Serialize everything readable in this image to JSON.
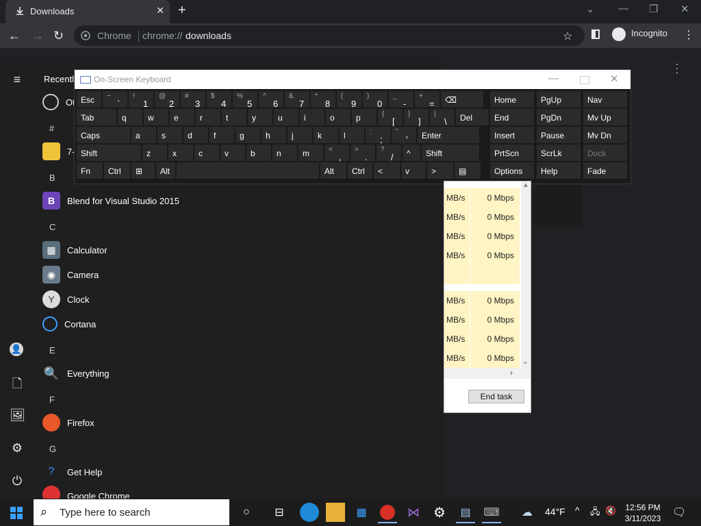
{
  "chrome": {
    "tab_title": "Downloads",
    "omnibox_chip": "Chrome",
    "url_scheme": "chrome://",
    "url_host": "downloads",
    "incognito_label": "Incognito"
  },
  "startmenu": {
    "recently_label": "Recently",
    "letters": [
      "#",
      "B",
      "C",
      "E",
      "F",
      "G"
    ],
    "apps": [
      {
        "label": "Ot"
      },
      {
        "label": "7-"
      },
      {
        "label": "Blend for Visual Studio 2015"
      },
      {
        "label": "Calculator"
      },
      {
        "label": "Camera"
      },
      {
        "label": "Clock"
      },
      {
        "label": "Cortana"
      },
      {
        "label": "Everything"
      },
      {
        "label": "Firefox"
      },
      {
        "label": "Get Help"
      },
      {
        "label": "Google Chrome"
      }
    ]
  },
  "osk": {
    "title": "On-Screen Keyboard",
    "row1": [
      {
        "main": "Esc"
      },
      {
        "sh": "~",
        "base": "`"
      },
      {
        "sh": "!",
        "base": "1"
      },
      {
        "sh": "@",
        "base": "2"
      },
      {
        "sh": "#",
        "base": "3"
      },
      {
        "sh": "$",
        "base": "4"
      },
      {
        "sh": "%",
        "base": "5"
      },
      {
        "sh": "^",
        "base": "6"
      },
      {
        "sh": "&",
        "base": "7"
      },
      {
        "sh": "*",
        "base": "8"
      },
      {
        "sh": "(",
        "base": "9"
      },
      {
        "sh": ")",
        "base": "0"
      },
      {
        "sh": "_",
        "base": "-"
      },
      {
        "sh": "+",
        "base": "="
      },
      {
        "main": "⌫"
      }
    ],
    "row2": [
      {
        "main": "Tab"
      },
      {
        "main": "q"
      },
      {
        "main": "w"
      },
      {
        "main": "e"
      },
      {
        "main": "r"
      },
      {
        "main": "t"
      },
      {
        "main": "y"
      },
      {
        "main": "u"
      },
      {
        "main": "i"
      },
      {
        "main": "o"
      },
      {
        "main": "p"
      },
      {
        "sh": "{",
        "base": "["
      },
      {
        "sh": "}",
        "base": "]"
      },
      {
        "sh": "|",
        "base": "\\"
      },
      {
        "main": "Del"
      }
    ],
    "row3": [
      {
        "main": "Caps"
      },
      {
        "main": "a"
      },
      {
        "main": "s"
      },
      {
        "main": "d"
      },
      {
        "main": "f"
      },
      {
        "main": "g"
      },
      {
        "main": "h"
      },
      {
        "main": "j"
      },
      {
        "main": "k"
      },
      {
        "main": "l"
      },
      {
        "sh": ":",
        "base": ";"
      },
      {
        "sh": "\"",
        "base": "'"
      },
      {
        "main": "Enter"
      }
    ],
    "row4": [
      {
        "main": "Shift"
      },
      {
        "main": "z"
      },
      {
        "main": "x"
      },
      {
        "main": "c"
      },
      {
        "main": "v"
      },
      {
        "main": "b"
      },
      {
        "main": "n"
      },
      {
        "main": "m"
      },
      {
        "sh": "<",
        "base": ","
      },
      {
        "sh": ">",
        "base": "."
      },
      {
        "sh": "?",
        "base": "/"
      },
      {
        "main": "^"
      },
      {
        "main": "Shift"
      }
    ],
    "row5": [
      {
        "main": "Fn"
      },
      {
        "main": "Ctrl"
      },
      {
        "main": "⊞"
      },
      {
        "main": "Alt"
      },
      {
        "main": ""
      },
      {
        "main": "Alt"
      },
      {
        "main": "Ctrl"
      },
      {
        "main": "<"
      },
      {
        "main": "v"
      },
      {
        "main": ">"
      },
      {
        "main": "▤"
      }
    ],
    "nav_keys": [
      [
        "Home",
        "PgUp",
        "Nav"
      ],
      [
        "End",
        "PgDn",
        "Mv Up"
      ],
      [
        "Insert",
        "Pause",
        "Mv Dn"
      ],
      [
        "PrtScn",
        "ScrLk",
        "Dock"
      ],
      [
        "Options",
        "Help",
        "Fade"
      ]
    ]
  },
  "taskmgr": {
    "rows": [
      {
        "c1": "MB/s",
        "c2": "0 Mbps"
      },
      {
        "c1": "MB/s",
        "c2": "0 Mbps"
      },
      {
        "c1": "MB/s",
        "c2": "0 Mbps"
      },
      {
        "c1": "MB/s",
        "c2": "0 Mbps"
      },
      {
        "c1": "",
        "c2": ""
      },
      {
        "c1": "MB/s",
        "c2": "0 Mbps"
      },
      {
        "c1": "MB/s",
        "c2": "0 Mbps"
      },
      {
        "c1": "MB/s",
        "c2": "0 Mbps"
      },
      {
        "c1": "MB/s",
        "c2": "0 Mbps"
      }
    ],
    "end_task": "End task"
  },
  "taskbar": {
    "search_placeholder": "Type here to search",
    "weather": "44°F",
    "time": "12:56 PM",
    "date": "3/11/2023"
  }
}
